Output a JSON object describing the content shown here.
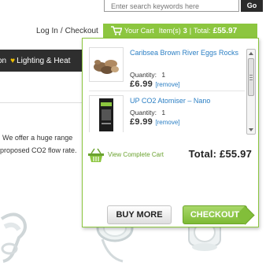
{
  "search": {
    "placeholder": "Enter search keywords here",
    "go_label": "Go"
  },
  "toplinks": {
    "login": "Log In",
    "separator": "/",
    "checkout": "Checkout"
  },
  "cart_bar": {
    "label": "Your Cart",
    "items_label": "Item(s)",
    "count": "3",
    "separator": "|",
    "total_label": "Total:",
    "total_value": "£55.97"
  },
  "nav": {
    "item_1": "on",
    "item_2": "Lighting & Heat",
    "heart_icon": "heart-icon"
  },
  "body_text": {
    "line_1": "We offer a huge range",
    "line_2": "proposed CO2 flow rate."
  },
  "dropdown": {
    "items": [
      {
        "name": "Caribsea Brown River Eggs Rocks",
        "qty_label": "Quantity:",
        "qty": "1",
        "price": "£6.99",
        "remove": "[remove]"
      },
      {
        "name": "UP CO2 Atomiser – Nano",
        "qty_label": "Quantity:",
        "qty": "1",
        "price": "£9.99",
        "remove": "[remove]"
      }
    ],
    "view_cart": "View Complete Cart",
    "total_label": "Total:",
    "total_value": "£55.97",
    "buy_more": "BUY MORE",
    "checkout": "CHECKOUT"
  },
  "colors": {
    "accent": "#8cc63f",
    "link": "#2b7fc4",
    "nav_bg": "#2e2e2e"
  }
}
